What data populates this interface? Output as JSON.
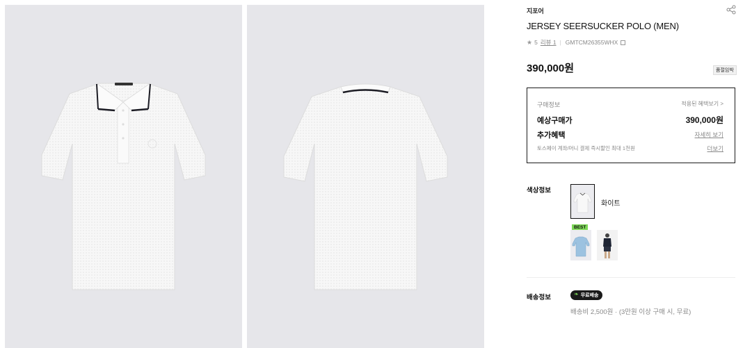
{
  "gallery": {
    "front_alt": "front",
    "back_alt": "back"
  },
  "product": {
    "brand": "지포어",
    "title": "JERSEY SEERSUCKER POLO (MEN)",
    "rating": "5",
    "review_label": "리뷰 1",
    "sku": "GMTCM26355WHX",
    "price": "390,000원",
    "stock_badge": "품절임박"
  },
  "purchase": {
    "heading": "구매정보",
    "benefit_link": "적용된 혜택보기 >",
    "expected_label": "예상구매가",
    "expected_value": "390,000원",
    "extra_label": "추가혜택",
    "detail_link": "자세히 보기",
    "toss_note": "토스페이 계좌/머니 결제 즉시할인 최대 1천원",
    "more_link": "더보기"
  },
  "color": {
    "section_label": "색상정보",
    "selected_name": "화이트",
    "best_badge": "BEST"
  },
  "shipping": {
    "section_label": "배송정보",
    "badge": "무료배송",
    "info": "배송비 2,500원 · (3만원 이상 구매 시, 무료)"
  },
  "icons": {
    "share": "share-icon",
    "star": "star-icon",
    "copy": "copy-icon",
    "leaf": "leaf-icon"
  },
  "colors": {
    "panel_bg": "#e6e6ea",
    "accent_green": "#7ed957",
    "box_border": "#1a1a1a"
  }
}
